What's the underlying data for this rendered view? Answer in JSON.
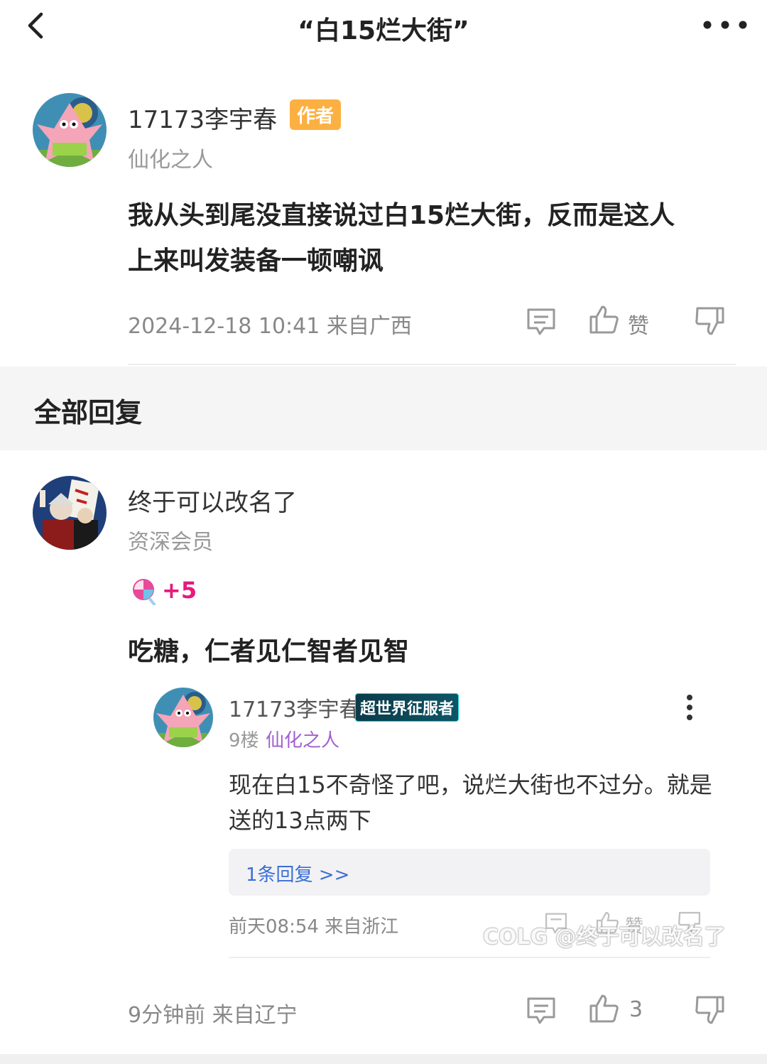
{
  "header": {
    "title": "“白15烂大街”"
  },
  "main_post": {
    "author": "17173李宇春",
    "author_badge": "作者",
    "rank": "仙化之人",
    "content_line1": "我从头到尾没直接说过白15烂大街，反而是这人",
    "content_line2": "上来叫发装备一顿嘲讽",
    "timestamp": "2024-12-18 10:41 来自广西",
    "like_label": "赞"
  },
  "section": {
    "title": "全部回复"
  },
  "reply": {
    "author": "终于可以改名了",
    "rank": "资深会员",
    "candy_count": "+5",
    "content": "吃糖，仁者见仁智者见智",
    "nested": {
      "author": "17173李宇春",
      "title_badge": "超世界征服者",
      "floor": "9楼",
      "rank": "仙化之人",
      "content_line1": "现在白15不奇怪了吧，说烂大街也不过分。就是",
      "content_line2": "送的13点两下",
      "reply_link": "1条回复 >>",
      "timestamp": "前天08:54 来自浙江",
      "like_label": "赞"
    },
    "timestamp": "9分钟前 来自辽宁",
    "like_count": "3"
  },
  "watermark": "COLG @终于可以改名了",
  "colors": {
    "author_badge": "#fcb042",
    "candy_plus": "#e6197e",
    "rank_purple": "#a15fd0",
    "link_blue": "#3b6fd6"
  }
}
